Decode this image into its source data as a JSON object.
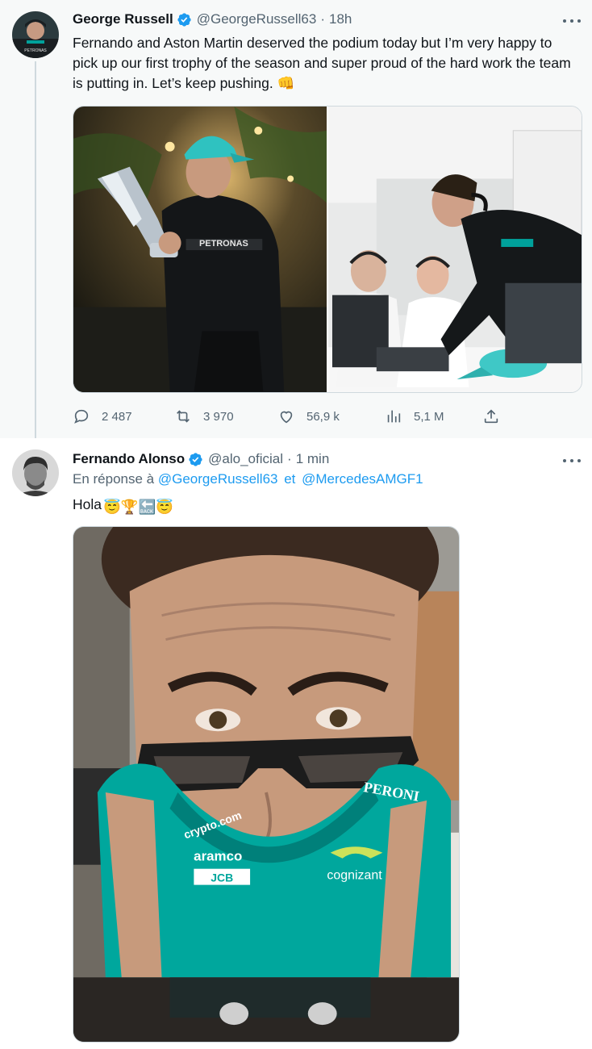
{
  "tweets": [
    {
      "author": "George Russell",
      "handle": "@GeorgeRussell63",
      "separator": "·",
      "time": "18h",
      "text": "Fernando and Aston Martin deserved the podium today but I’m very happy to pick up our first trophy of the season and super proud of the hard work the team is putting in. Let’s keep pushing. 👊",
      "images": [
        {
          "alt_icon": "photo-trophy-icon"
        },
        {
          "alt_icon": "photo-garage-icon"
        }
      ],
      "stats": {
        "replies": "2 487",
        "retweets": "3 970",
        "likes": "56,9 k",
        "views": "5,1 M"
      }
    },
    {
      "author": "Fernando Alonso",
      "handle": "@alo_oficial",
      "separator": "·",
      "time": "1 min",
      "reply_prefix": "En réponse à",
      "reply_user1": "@GeorgeRussell63",
      "reply_joiner": "et",
      "reply_user2": "@MercedesAMGF1",
      "text": "Hola",
      "emoji_text": "😇🏆🔙😇",
      "image": {
        "alt_icon": "photo-selfie-icon"
      }
    }
  ],
  "colors": {
    "link": "#1d9bf0",
    "secondary": "#536471",
    "verified": "#1d9bf0",
    "mercedes_teal": "#00a19b",
    "aston_green": "#00665e"
  }
}
